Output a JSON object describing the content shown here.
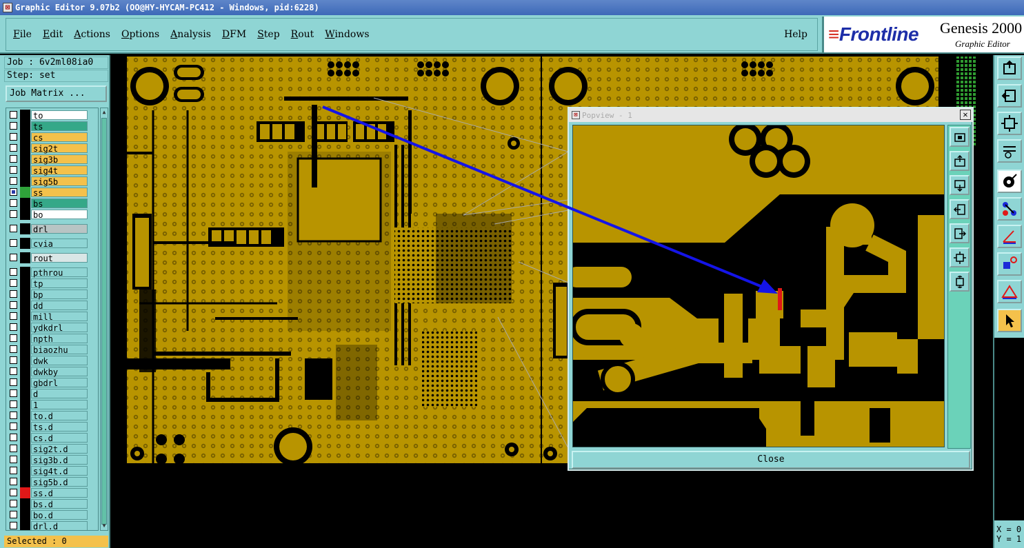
{
  "window": {
    "title": "Graphic Editor 9.07b2 (OO@HY-HYCAM-PC412 - Windows, pid:6228)"
  },
  "menu": {
    "items": [
      {
        "label": "File"
      },
      {
        "label": "Edit"
      },
      {
        "label": "Actions"
      },
      {
        "label": "Options"
      },
      {
        "label": "Analysis"
      },
      {
        "label": "DFM"
      },
      {
        "label": "Step"
      },
      {
        "label": "Rout"
      },
      {
        "label": "Windows"
      }
    ],
    "help": "Help"
  },
  "logo": {
    "brand": "Frontline",
    "product": "Genesis 2000",
    "subtitle": "Graphic Editor"
  },
  "job": {
    "job_line": "Job : 6v2ml08ia0",
    "step_line": "Step: set",
    "matrix_button": "Job Matrix ..."
  },
  "layers": [
    {
      "name": "to",
      "bg": "#ffffff",
      "swatch": "#000000",
      "selected": false
    },
    {
      "name": "ts",
      "bg": "#35a888",
      "swatch": "#000000",
      "selected": false
    },
    {
      "name": "cs",
      "bg": "#f4c14b",
      "swatch": "#000000",
      "selected": false
    },
    {
      "name": "sig2t",
      "bg": "#f4c14b",
      "swatch": "#000000",
      "selected": false
    },
    {
      "name": "sig3b",
      "bg": "#f4c14b",
      "swatch": "#000000",
      "selected": false
    },
    {
      "name": "sig4t",
      "bg": "#f4c14b",
      "swatch": "#000000",
      "selected": false
    },
    {
      "name": "sig5b",
      "bg": "#f4c14b",
      "swatch": "#000000",
      "selected": false
    },
    {
      "name": "ss",
      "bg": "#f4c14b",
      "swatch": "#2fa23a",
      "selected": true
    },
    {
      "name": "bs",
      "bg": "#35a888",
      "swatch": "#000000",
      "selected": false
    },
    {
      "name": "bo",
      "bg": "#ffffff",
      "swatch": "#000000",
      "selected": false
    },
    {
      "name": "drl",
      "bg": "#b8c4c4",
      "swatch": "#000000",
      "selected": false
    },
    {
      "name": "cvia",
      "bg": "#8fd5d4",
      "swatch": "#000000",
      "selected": false
    },
    {
      "name": "rout",
      "bg": "#d9e6e6",
      "swatch": "#000000",
      "selected": false
    },
    {
      "name": "pthrou",
      "bg": "#8fd5d4",
      "swatch": "#000000",
      "selected": false
    },
    {
      "name": "tp",
      "bg": "#8fd5d4",
      "swatch": "#000000",
      "selected": false
    },
    {
      "name": "bp",
      "bg": "#8fd5d4",
      "swatch": "#000000",
      "selected": false
    },
    {
      "name": "dd",
      "bg": "#8fd5d4",
      "swatch": "#000000",
      "selected": false
    },
    {
      "name": "mill",
      "bg": "#8fd5d4",
      "swatch": "#000000",
      "selected": false
    },
    {
      "name": "ydkdrl",
      "bg": "#8fd5d4",
      "swatch": "#000000",
      "selected": false
    },
    {
      "name": "npth",
      "bg": "#8fd5d4",
      "swatch": "#000000",
      "selected": false
    },
    {
      "name": "biaozhu",
      "bg": "#8fd5d4",
      "swatch": "#000000",
      "selected": false
    },
    {
      "name": "dwk",
      "bg": "#8fd5d4",
      "swatch": "#000000",
      "selected": false
    },
    {
      "name": "dwkby",
      "bg": "#8fd5d4",
      "swatch": "#000000",
      "selected": false
    },
    {
      "name": "gbdrl",
      "bg": "#8fd5d4",
      "swatch": "#000000",
      "selected": false
    },
    {
      "name": "d",
      "bg": "#8fd5d4",
      "swatch": "#000000",
      "selected": false
    },
    {
      "name": "1",
      "bg": "#8fd5d4",
      "swatch": "#000000",
      "selected": false
    },
    {
      "name": "to.d",
      "bg": "#8fd5d4",
      "swatch": "#000000",
      "selected": false
    },
    {
      "name": "ts.d",
      "bg": "#8fd5d4",
      "swatch": "#000000",
      "selected": false
    },
    {
      "name": "cs.d",
      "bg": "#8fd5d4",
      "swatch": "#000000",
      "selected": false
    },
    {
      "name": "sig2t.d",
      "bg": "#8fd5d4",
      "swatch": "#000000",
      "selected": false
    },
    {
      "name": "sig3b.d",
      "bg": "#8fd5d4",
      "swatch": "#000000",
      "selected": false
    },
    {
      "name": "sig4t.d",
      "bg": "#8fd5d4",
      "swatch": "#000000",
      "selected": false
    },
    {
      "name": "sig5b.d",
      "bg": "#8fd5d4",
      "swatch": "#000000",
      "selected": false
    },
    {
      "name": "ss.d",
      "bg": "#8fd5d4",
      "swatch": "#e01818",
      "selected": false
    },
    {
      "name": "bs.d",
      "bg": "#8fd5d4",
      "swatch": "#000000",
      "selected": false
    },
    {
      "name": "bo.d",
      "bg": "#8fd5d4",
      "swatch": "#000000",
      "selected": false
    },
    {
      "name": "drl.d",
      "bg": "#8fd5d4",
      "swatch": "#000000",
      "selected": false
    }
  ],
  "status": {
    "selected": "Selected : 0"
  },
  "coords": {
    "x_label": "X = 0",
    "y_label": "Y = 1"
  },
  "popview": {
    "title": "Popview - 1",
    "close_button": "Close"
  },
  "colors": {
    "copper": "#b89400",
    "panel": "#8fd5d4",
    "highlight": "#e01818",
    "arrow": "#1414e8"
  }
}
